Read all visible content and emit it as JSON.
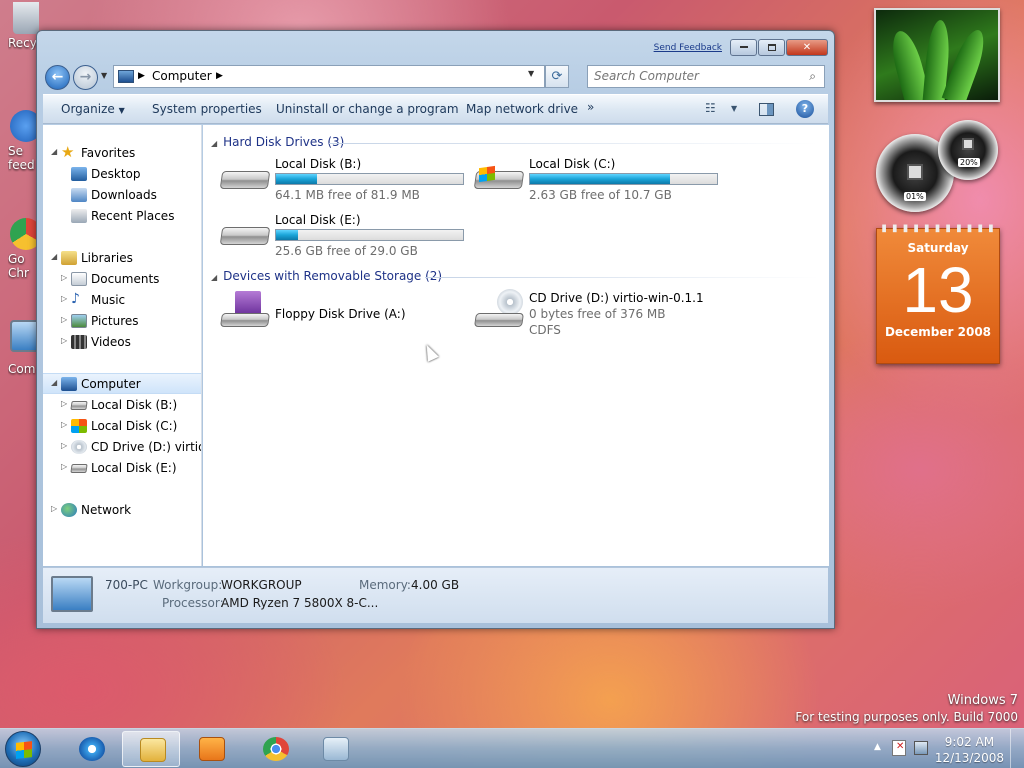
{
  "desktop": {
    "icons": [
      {
        "label": "Recy",
        "icon": "recycle-bin-icon",
        "color": "#9aa6b4"
      },
      {
        "label": "Se feed",
        "icon": "feedback-icon",
        "color": "#1f5fb8"
      },
      {
        "label": "Go Chr",
        "icon": "chrome-icon",
        "color": "#e0453a"
      },
      {
        "label": "Com",
        "icon": "computer-icon",
        "color": "#3a7fc3"
      }
    ],
    "watermark": {
      "line1": "Windows 7",
      "line2": "For testing purposes only. Build 7000"
    }
  },
  "gadgets": {
    "cpu_gauge": {
      "reading": "01%"
    },
    "mem_gauge": {
      "reading": "20%"
    },
    "calendar": {
      "weekday": "Saturday",
      "day": "13",
      "month_year": "December 2008"
    }
  },
  "window": {
    "send_feedback": "Send Feedback",
    "caption": {
      "min": "▭",
      "max": "▭",
      "close": "✕"
    },
    "address": {
      "segment": "Computer"
    },
    "search": {
      "placeholder": "Search Computer"
    },
    "toolbar": {
      "organize": "Organize",
      "system_properties": "System properties",
      "uninstall": "Uninstall or change a program",
      "map_drive": "Map network drive",
      "more": "»"
    },
    "nav": {
      "favorites": "Favorites",
      "desktop": "Desktop",
      "downloads": "Downloads",
      "recent": "Recent Places",
      "libraries": "Libraries",
      "documents": "Documents",
      "music": "Music",
      "pictures": "Pictures",
      "videos": "Videos",
      "computer": "Computer",
      "disk_b": "Local Disk (B:)",
      "disk_c": "Local Disk (C:)",
      "cd": "CD Drive (D:) virtio-w",
      "disk_e": "Local Disk (E:)",
      "network": "Network"
    },
    "groups": {
      "hdd": "Hard Disk Drives (3)",
      "removable": "Devices with Removable Storage (2)"
    },
    "drives": [
      {
        "name": "Local Disk (B:)",
        "free": "64.1 MB free of 81.9 MB",
        "used_fraction": 0.22
      },
      {
        "name": "Local Disk (C:)",
        "free": "2.63 GB free of 10.7 GB",
        "used_fraction": 0.75
      },
      {
        "name": "Local Disk (E:)",
        "free": "25.6 GB free of 29.0 GB",
        "used_fraction": 0.12
      }
    ],
    "removable": {
      "floppy": {
        "name": "Floppy Disk Drive (A:)"
      },
      "cd": {
        "name": "CD Drive (D:) virtio-win-0.1.1",
        "free": "0 bytes free of 376 MB",
        "fs": "CDFS"
      }
    },
    "details": {
      "pc_name": "700-PC",
      "workgroup_label": "Workgroup:",
      "workgroup": "WORKGROUP",
      "memory_label": "Memory:",
      "memory": "4.00 GB",
      "processor_label": "Processor:",
      "processor": "AMD Ryzen 7 5800X 8-C..."
    }
  },
  "taskbar": {
    "clock_time": "9:02 AM",
    "clock_date": "12/13/2008"
  }
}
